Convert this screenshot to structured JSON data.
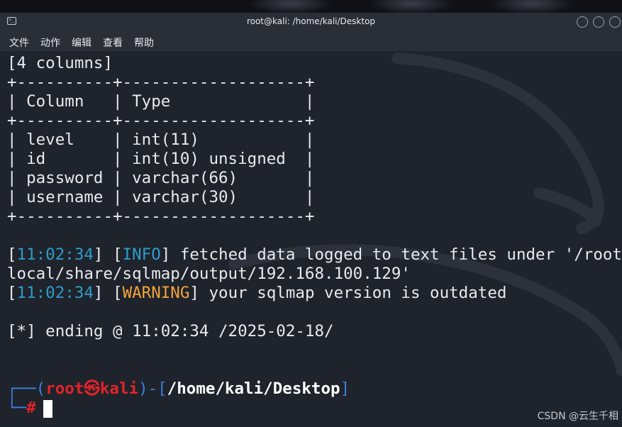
{
  "window": {
    "title": "root@kali: /home/kali/Desktop",
    "icon": "terminal-icon"
  },
  "menu": [
    "文件",
    "动作",
    "编辑",
    "查看",
    "帮助"
  ],
  "terminal": {
    "columns_header": "[4 columns]",
    "table": {
      "border_top": "+----------+-------------------+",
      "header_row": "| Column   | Type              |",
      "border_mid": "+----------+-------------------+",
      "rows": [
        "| level    | int(11)           |",
        "| id       | int(10) unsigned  |",
        "| password | varchar(66)       |",
        "| username | varchar(30)       |"
      ],
      "border_bottom": "+----------+-------------------+"
    },
    "log": [
      {
        "time": "11:02:34",
        "level": "INFO",
        "message": " fetched data logged to text files under '/root/.",
        "continuation": "local/share/sqlmap/output/192.168.100.129'"
      },
      {
        "time": "11:02:34",
        "level": "WARNING",
        "message": " your sqlmap version is outdated"
      }
    ],
    "ending": "[*] ending @ 11:02:34 /2025-02-18/",
    "prompt": {
      "user": "root",
      "host": "kali",
      "path": "/home/kali/Desktop",
      "symbol": "#"
    }
  },
  "watermark": "CSDN @云生千相",
  "colors": {
    "timestamp": "#2f9bcc",
    "warning": "#f2a33a",
    "prompt_user": "#e0242a",
    "prompt_frame": "#3c7fe0"
  }
}
